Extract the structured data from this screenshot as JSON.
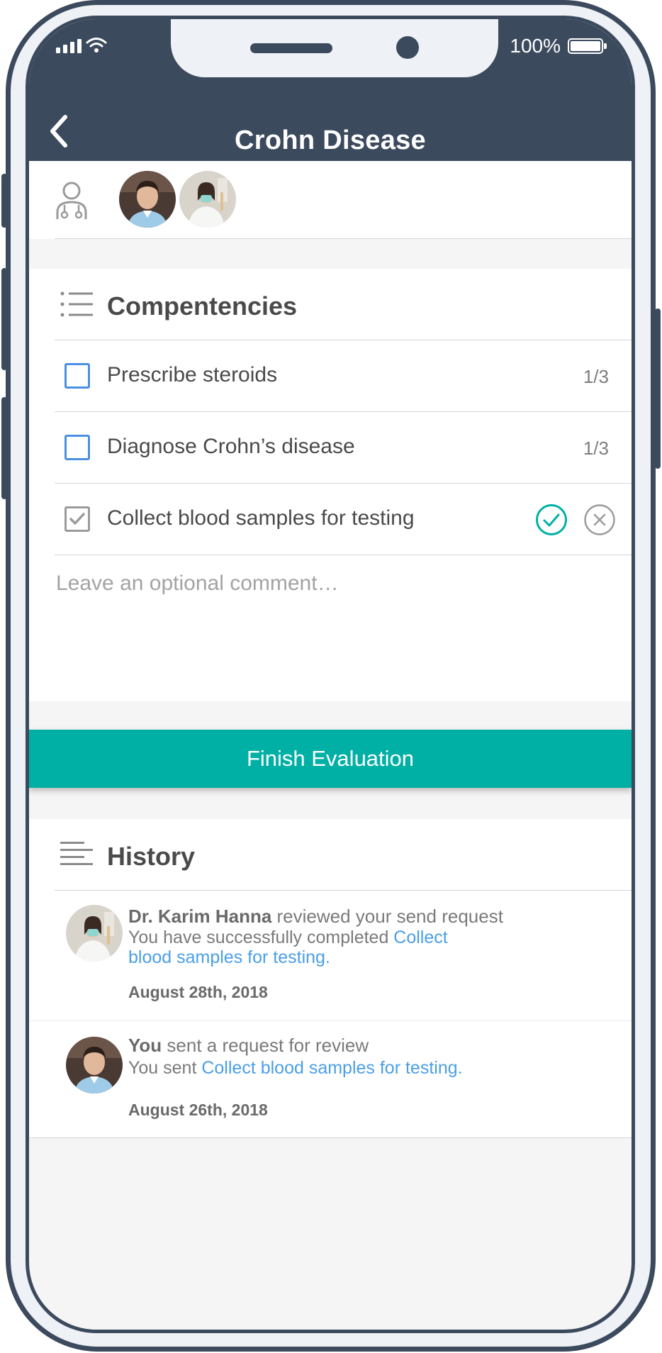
{
  "status_bar": {
    "battery": "100%",
    "battery_level": 1.0
  },
  "header": {
    "title": "Crohn Disease"
  },
  "competencies": {
    "title": "Compentencies",
    "items": [
      {
        "label": "Prescribe steroids",
        "count": "1/3",
        "checked": false
      },
      {
        "label": "Diagnose Crohn’s disease",
        "count": "1/3",
        "checked": false
      },
      {
        "label": "Collect blood samples for testing",
        "checked": true
      }
    ],
    "comment_placeholder": "Leave an optional comment…"
  },
  "finish_button": {
    "label": "Finish Evaluation"
  },
  "history": {
    "title": "History",
    "items": [
      {
        "name": "Dr. Karim Hanna",
        "action": " reviewed your send request",
        "detail_prefix": "You have successfully completed ",
        "detail_link": "Collect blood samples for testing.",
        "date": "August 28th, 2018"
      },
      {
        "name": "You",
        "action": " sent a request for review",
        "detail_prefix": "You sent ",
        "detail_link": "Collect blood samples for testing.",
        "date": "August 26th, 2018"
      }
    ]
  },
  "colors": {
    "header_bg": "#3c4a5e",
    "accent_teal": "#00b0a5",
    "link_blue": "#4a9fe8",
    "checkbox_blue": "#4a90e2"
  }
}
